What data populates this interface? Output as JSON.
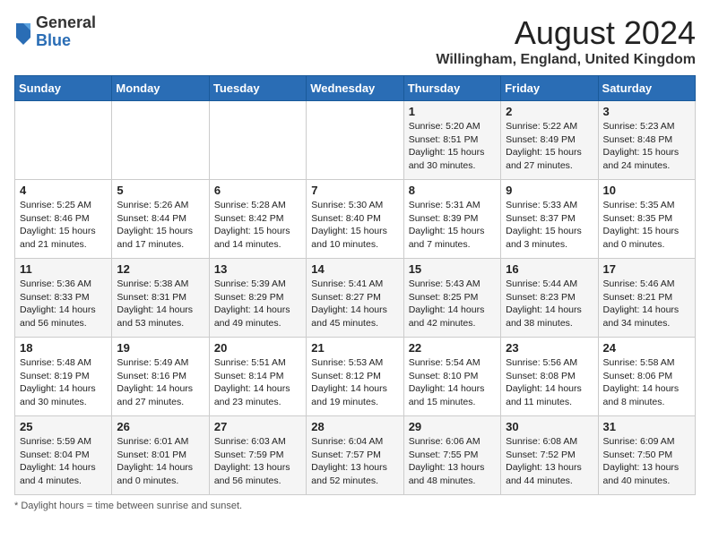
{
  "header": {
    "logo_general": "General",
    "logo_blue": "Blue",
    "month_title": "August 2024",
    "location": "Willingham, England, United Kingdom"
  },
  "days_of_week": [
    "Sunday",
    "Monday",
    "Tuesday",
    "Wednesday",
    "Thursday",
    "Friday",
    "Saturday"
  ],
  "footer": {
    "note": "Daylight hours"
  },
  "weeks": [
    [
      {
        "day": "",
        "sunrise": "",
        "sunset": "",
        "daylight": ""
      },
      {
        "day": "",
        "sunrise": "",
        "sunset": "",
        "daylight": ""
      },
      {
        "day": "",
        "sunrise": "",
        "sunset": "",
        "daylight": ""
      },
      {
        "day": "",
        "sunrise": "",
        "sunset": "",
        "daylight": ""
      },
      {
        "day": "1",
        "sunrise": "Sunrise: 5:20 AM",
        "sunset": "Sunset: 8:51 PM",
        "daylight": "Daylight: 15 hours and 30 minutes."
      },
      {
        "day": "2",
        "sunrise": "Sunrise: 5:22 AM",
        "sunset": "Sunset: 8:49 PM",
        "daylight": "Daylight: 15 hours and 27 minutes."
      },
      {
        "day": "3",
        "sunrise": "Sunrise: 5:23 AM",
        "sunset": "Sunset: 8:48 PM",
        "daylight": "Daylight: 15 hours and 24 minutes."
      }
    ],
    [
      {
        "day": "4",
        "sunrise": "Sunrise: 5:25 AM",
        "sunset": "Sunset: 8:46 PM",
        "daylight": "Daylight: 15 hours and 21 minutes."
      },
      {
        "day": "5",
        "sunrise": "Sunrise: 5:26 AM",
        "sunset": "Sunset: 8:44 PM",
        "daylight": "Daylight: 15 hours and 17 minutes."
      },
      {
        "day": "6",
        "sunrise": "Sunrise: 5:28 AM",
        "sunset": "Sunset: 8:42 PM",
        "daylight": "Daylight: 15 hours and 14 minutes."
      },
      {
        "day": "7",
        "sunrise": "Sunrise: 5:30 AM",
        "sunset": "Sunset: 8:40 PM",
        "daylight": "Daylight: 15 hours and 10 minutes."
      },
      {
        "day": "8",
        "sunrise": "Sunrise: 5:31 AM",
        "sunset": "Sunset: 8:39 PM",
        "daylight": "Daylight: 15 hours and 7 minutes."
      },
      {
        "day": "9",
        "sunrise": "Sunrise: 5:33 AM",
        "sunset": "Sunset: 8:37 PM",
        "daylight": "Daylight: 15 hours and 3 minutes."
      },
      {
        "day": "10",
        "sunrise": "Sunrise: 5:35 AM",
        "sunset": "Sunset: 8:35 PM",
        "daylight": "Daylight: 15 hours and 0 minutes."
      }
    ],
    [
      {
        "day": "11",
        "sunrise": "Sunrise: 5:36 AM",
        "sunset": "Sunset: 8:33 PM",
        "daylight": "Daylight: 14 hours and 56 minutes."
      },
      {
        "day": "12",
        "sunrise": "Sunrise: 5:38 AM",
        "sunset": "Sunset: 8:31 PM",
        "daylight": "Daylight: 14 hours and 53 minutes."
      },
      {
        "day": "13",
        "sunrise": "Sunrise: 5:39 AM",
        "sunset": "Sunset: 8:29 PM",
        "daylight": "Daylight: 14 hours and 49 minutes."
      },
      {
        "day": "14",
        "sunrise": "Sunrise: 5:41 AM",
        "sunset": "Sunset: 8:27 PM",
        "daylight": "Daylight: 14 hours and 45 minutes."
      },
      {
        "day": "15",
        "sunrise": "Sunrise: 5:43 AM",
        "sunset": "Sunset: 8:25 PM",
        "daylight": "Daylight: 14 hours and 42 minutes."
      },
      {
        "day": "16",
        "sunrise": "Sunrise: 5:44 AM",
        "sunset": "Sunset: 8:23 PM",
        "daylight": "Daylight: 14 hours and 38 minutes."
      },
      {
        "day": "17",
        "sunrise": "Sunrise: 5:46 AM",
        "sunset": "Sunset: 8:21 PM",
        "daylight": "Daylight: 14 hours and 34 minutes."
      }
    ],
    [
      {
        "day": "18",
        "sunrise": "Sunrise: 5:48 AM",
        "sunset": "Sunset: 8:19 PM",
        "daylight": "Daylight: 14 hours and 30 minutes."
      },
      {
        "day": "19",
        "sunrise": "Sunrise: 5:49 AM",
        "sunset": "Sunset: 8:16 PM",
        "daylight": "Daylight: 14 hours and 27 minutes."
      },
      {
        "day": "20",
        "sunrise": "Sunrise: 5:51 AM",
        "sunset": "Sunset: 8:14 PM",
        "daylight": "Daylight: 14 hours and 23 minutes."
      },
      {
        "day": "21",
        "sunrise": "Sunrise: 5:53 AM",
        "sunset": "Sunset: 8:12 PM",
        "daylight": "Daylight: 14 hours and 19 minutes."
      },
      {
        "day": "22",
        "sunrise": "Sunrise: 5:54 AM",
        "sunset": "Sunset: 8:10 PM",
        "daylight": "Daylight: 14 hours and 15 minutes."
      },
      {
        "day": "23",
        "sunrise": "Sunrise: 5:56 AM",
        "sunset": "Sunset: 8:08 PM",
        "daylight": "Daylight: 14 hours and 11 minutes."
      },
      {
        "day": "24",
        "sunrise": "Sunrise: 5:58 AM",
        "sunset": "Sunset: 8:06 PM",
        "daylight": "Daylight: 14 hours and 8 minutes."
      }
    ],
    [
      {
        "day": "25",
        "sunrise": "Sunrise: 5:59 AM",
        "sunset": "Sunset: 8:04 PM",
        "daylight": "Daylight: 14 hours and 4 minutes."
      },
      {
        "day": "26",
        "sunrise": "Sunrise: 6:01 AM",
        "sunset": "Sunset: 8:01 PM",
        "daylight": "Daylight: 14 hours and 0 minutes."
      },
      {
        "day": "27",
        "sunrise": "Sunrise: 6:03 AM",
        "sunset": "Sunset: 7:59 PM",
        "daylight": "Daylight: 13 hours and 56 minutes."
      },
      {
        "day": "28",
        "sunrise": "Sunrise: 6:04 AM",
        "sunset": "Sunset: 7:57 PM",
        "daylight": "Daylight: 13 hours and 52 minutes."
      },
      {
        "day": "29",
        "sunrise": "Sunrise: 6:06 AM",
        "sunset": "Sunset: 7:55 PM",
        "daylight": "Daylight: 13 hours and 48 minutes."
      },
      {
        "day": "30",
        "sunrise": "Sunrise: 6:08 AM",
        "sunset": "Sunset: 7:52 PM",
        "daylight": "Daylight: 13 hours and 44 minutes."
      },
      {
        "day": "31",
        "sunrise": "Sunrise: 6:09 AM",
        "sunset": "Sunset: 7:50 PM",
        "daylight": "Daylight: 13 hours and 40 minutes."
      }
    ]
  ]
}
